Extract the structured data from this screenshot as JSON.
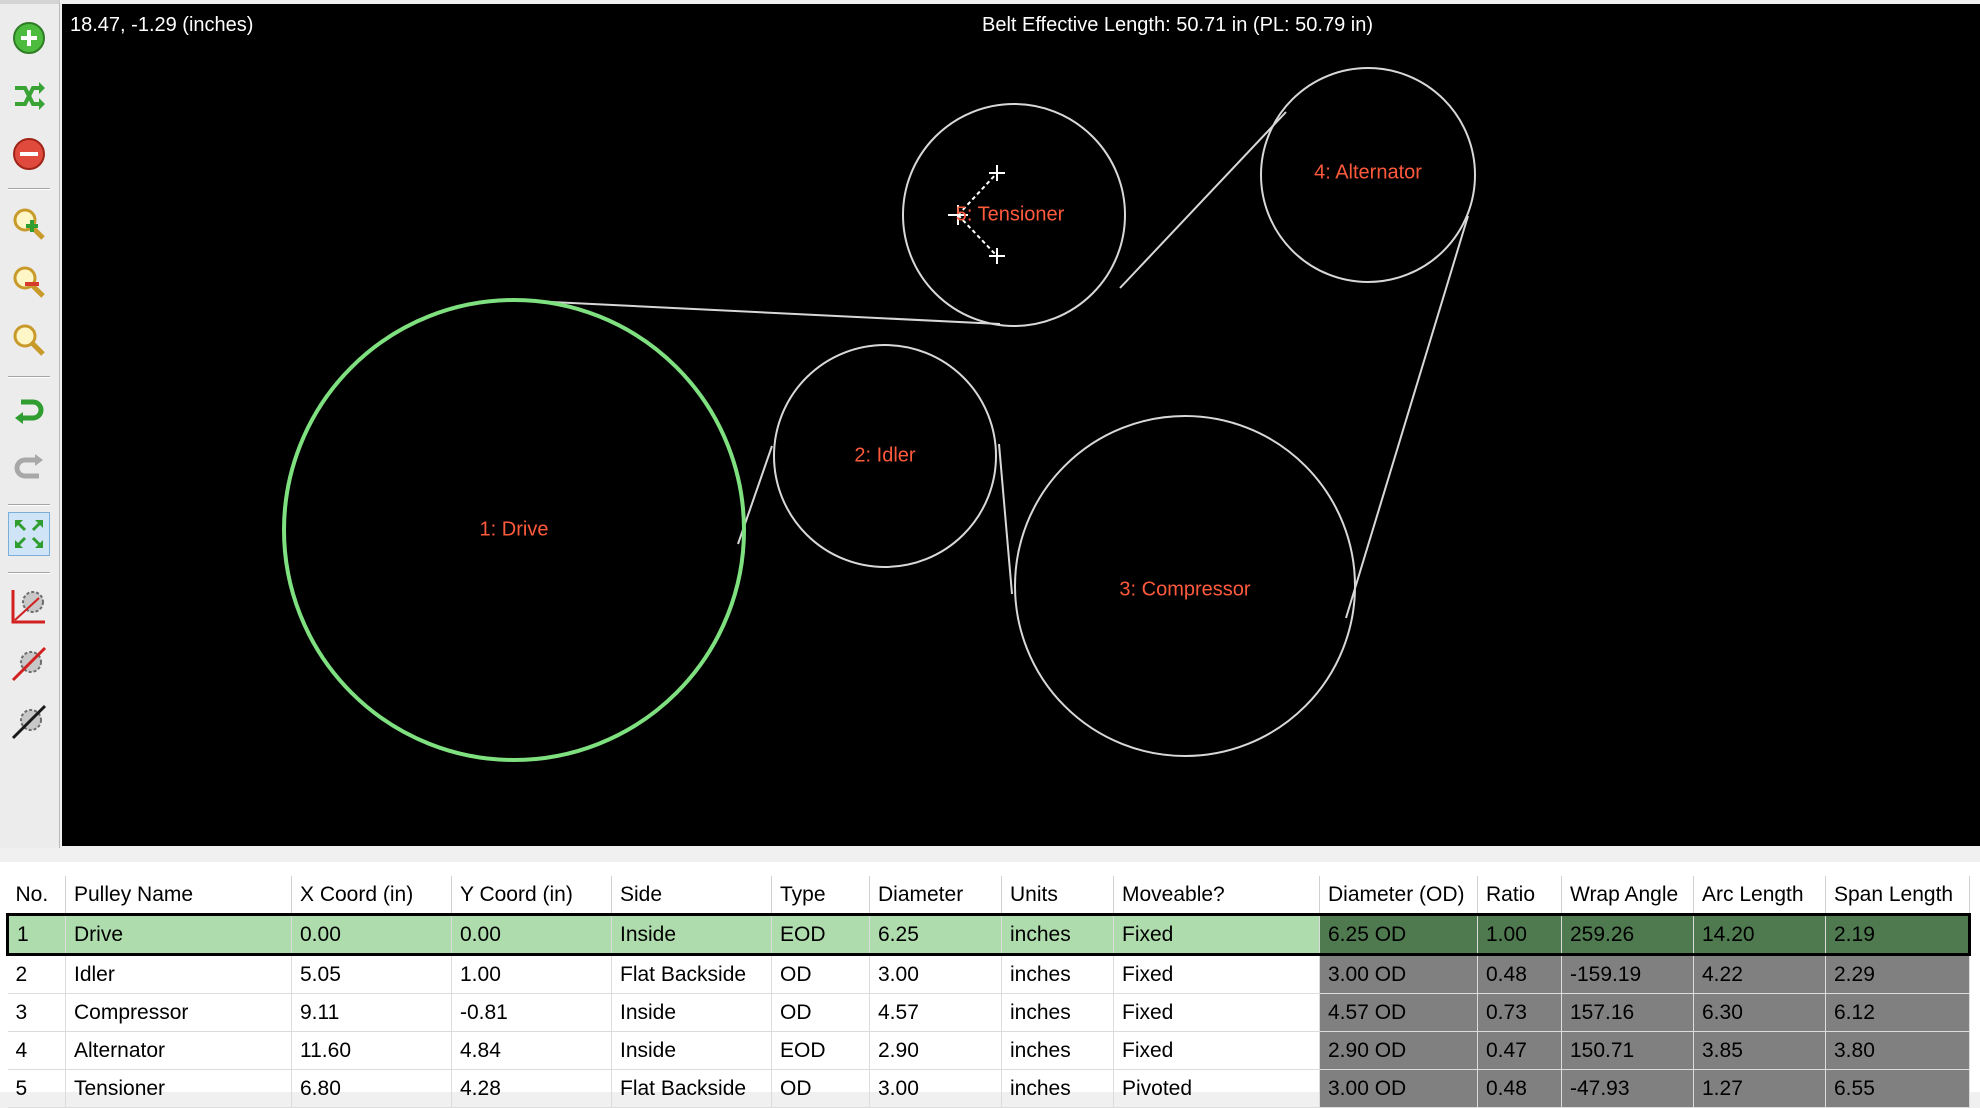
{
  "toolbar": {
    "buttons": [
      {
        "icon": "add-pulley-icon"
      },
      {
        "icon": "shuffle-icon"
      },
      {
        "icon": "remove-pulley-icon"
      },
      {
        "icon": "zoom-in-icon"
      },
      {
        "icon": "zoom-out-icon"
      },
      {
        "icon": "zoom-fit-icon"
      },
      {
        "icon": "undo-icon"
      },
      {
        "icon": "redo-icon"
      },
      {
        "icon": "fit-view-icon"
      },
      {
        "icon": "pulley-graph-icon"
      },
      {
        "icon": "pulley-disabled-icon"
      },
      {
        "icon": "pulley-tool-icon"
      }
    ]
  },
  "canvas": {
    "cursor_coords": "18.47, -1.29 (inches)",
    "belt_length": "Belt Effective Length: 50.71 in (PL: 50.79 in)",
    "colors": {
      "background": "#000000",
      "belt": "#d8d8d8",
      "selected": "#7fe07f",
      "label": "#ff5a3c"
    },
    "pulleys": [
      {
        "label": "1: Drive",
        "selected": true
      },
      {
        "label": "2: Idler",
        "selected": false
      },
      {
        "label": "3: Compressor",
        "selected": false
      },
      {
        "label": "4: Alternator",
        "selected": false
      },
      {
        "label": "5: Tensioner",
        "selected": false
      }
    ]
  },
  "table": {
    "headers": [
      "No.",
      "Pulley Name",
      "X Coord (in)",
      "Y Coord (in)",
      "Side",
      "Type",
      "Diameter",
      "Units",
      "Moveable?",
      "Diameter (OD)",
      "Ratio",
      "Wrap Angle",
      "Arc Length",
      "Span Length"
    ],
    "rows": [
      [
        "1",
        "Drive",
        "0.00",
        "0.00",
        "Inside",
        "EOD",
        "6.25",
        "inches",
        "Fixed",
        "6.25 OD",
        "1.00",
        "259.26",
        "14.20",
        "2.19"
      ],
      [
        "2",
        "Idler",
        "5.05",
        "1.00",
        "Flat Backside",
        "OD",
        "3.00",
        "inches",
        "Fixed",
        "3.00 OD",
        "0.48",
        "-159.19",
        "4.22",
        "2.29"
      ],
      [
        "3",
        "Compressor",
        "9.11",
        "-0.81",
        "Inside",
        "OD",
        "4.57",
        "inches",
        "Fixed",
        "4.57 OD",
        "0.73",
        "157.16",
        "6.30",
        "6.12"
      ],
      [
        "4",
        "Alternator",
        "11.60",
        "4.84",
        "Inside",
        "EOD",
        "2.90",
        "inches",
        "Fixed",
        "2.90 OD",
        "0.47",
        "150.71",
        "3.85",
        "3.80"
      ],
      [
        "5",
        "Tensioner",
        "6.80",
        "4.28",
        "Flat Backside",
        "OD",
        "3.00",
        "inches",
        "Pivoted",
        "3.00 OD",
        "0.48",
        "-47.93",
        "1.27",
        "6.55"
      ]
    ],
    "selected_row": 0
  }
}
